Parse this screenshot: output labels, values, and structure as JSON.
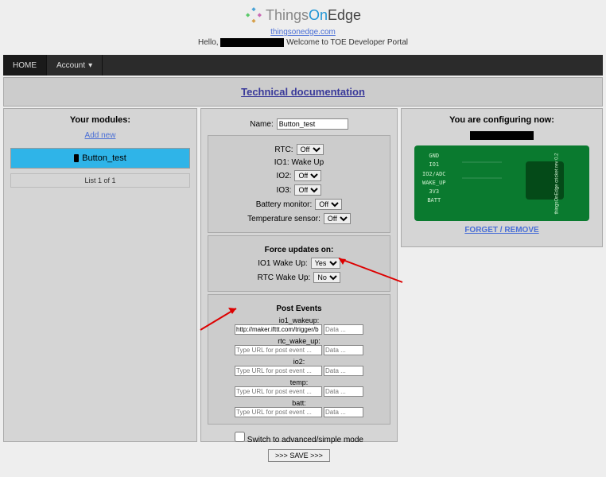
{
  "header": {
    "brand_thin": "Things",
    "brand_blue": "On",
    "brand_bold": "Edge",
    "site_url": "thingsonedge.com",
    "hello": "Hello,",
    "welcome_tail": "Welcome to TOE Developer Portal"
  },
  "nav": {
    "home": "HOME",
    "account": "Account"
  },
  "docbar": {
    "link": "Technical documentation"
  },
  "left": {
    "title": "Your modules:",
    "add": "Add new",
    "item": "Button_test",
    "list_info": "List 1 of 1"
  },
  "mid": {
    "name_label": "Name:",
    "name_value": "Button_test",
    "rtc_label": "RTC:",
    "rtc_value": "Off",
    "io1wake_label": "IO1: Wake Up",
    "io2_label": "IO2:",
    "io2_value": "Off",
    "io3_label": "IO3:",
    "io3_value": "Off",
    "batt_label": "Battery monitor:",
    "batt_value": "Off",
    "temp_label": "Temperature sensor:",
    "temp_value": "Off",
    "force_hdr": "Force updates on:",
    "fio1_label": "IO1 Wake Up:",
    "fio1_value": "Yes",
    "frtc_label": "RTC Wake Up:",
    "frtc_value": "No",
    "post_hdr": "Post Events",
    "ev_io1": "io1_wakeup:",
    "ev_io1_url": "http://maker.ifttt.com/trigger/b",
    "ev_rtc": "rtc_wake_up:",
    "ev_io2": "io2:",
    "ev_temp": "temp:",
    "ev_batt": "batt:",
    "url_ph": "Type URL for post event ...",
    "data_ph": "Data ...",
    "switch": "Switch to advanced/simple mode",
    "save": ">>> SAVE >>>"
  },
  "right": {
    "title": "You are configuring now:",
    "pins": [
      "GND",
      "IO1",
      "IO2/ADC",
      "WAKE_UP",
      "3V3",
      "BATT"
    ],
    "board_text": "thingsOnEdge cricket rev 0.2",
    "forget": "FORGET / REMOVE"
  }
}
